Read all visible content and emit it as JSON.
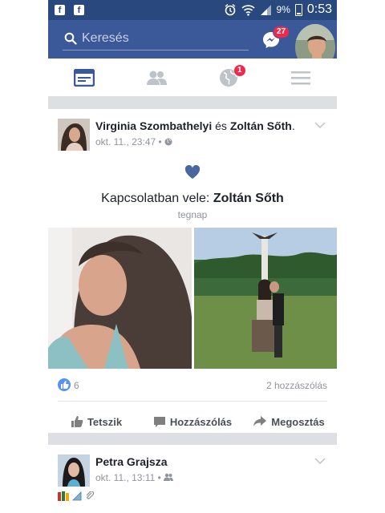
{
  "status": {
    "battery": "9%",
    "time": "0:53"
  },
  "header": {
    "search_placeholder": "Keresés",
    "messenger_badge": "27"
  },
  "tabs": {
    "notifications_badge": "1"
  },
  "post1": {
    "author": "Virginia Szombathelyi",
    "conj": "és",
    "with": "Zoltán Sőth",
    "timestamp": "okt. 11., 23:47",
    "event_prefix": "Kapcsolatban vele:",
    "event_person": "Zoltán Sőth",
    "event_when": "tegnap",
    "likes": "6",
    "comments": "2 hozzászólás",
    "like_label": "Tetszik",
    "comment_label": "Hozzászólás",
    "share_label": "Megosztás"
  },
  "post2": {
    "author": "Petra Grajsza",
    "timestamp": "okt. 11., 13:11"
  },
  "colors": {
    "brand": "#3b5998",
    "statusbar": "#29487d",
    "badge": "#f02849",
    "heart": "#4b67a1"
  }
}
